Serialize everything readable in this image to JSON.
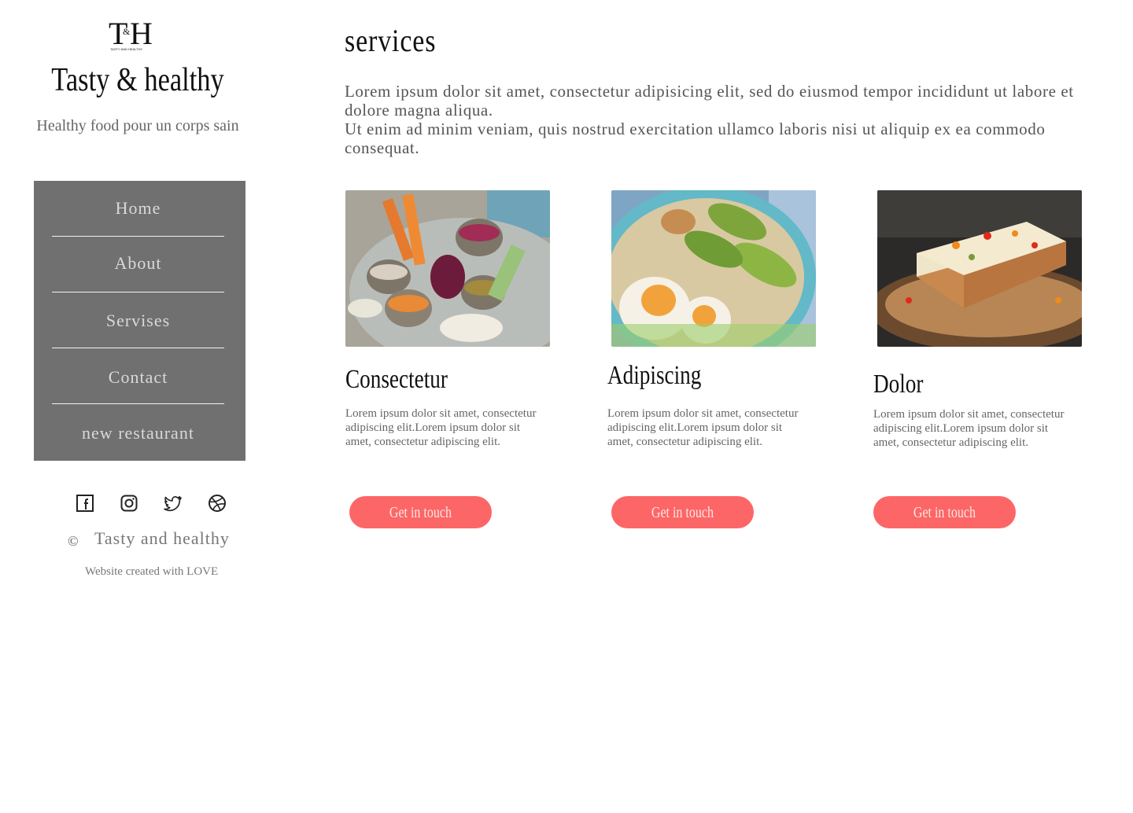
{
  "sidebar": {
    "logo_text": "T&H",
    "logo_subtext": "TASTY AND HEALTHY",
    "brand": "Tasty & healthy",
    "tagline": "Healthy food pour un corps sain",
    "nav": [
      {
        "label": "Home"
      },
      {
        "label": "About"
      },
      {
        "label": "Servises"
      },
      {
        "label": "Contact"
      },
      {
        "label": "new restaurant"
      }
    ],
    "social_icons": [
      "facebook-icon",
      "instagram-icon",
      "twitter-icon",
      "dribbble-icon"
    ],
    "copyright_symbol": "©",
    "copyright_text": "Tasty and healthy",
    "credit": "Website created with LOVE"
  },
  "main": {
    "title": "services",
    "intro_line1": "Lorem ipsum dolor sit amet, consectetur adipisicing elit, sed do eiusmod tempor incididunt ut labore et dolore magna aliqua.",
    "intro_line2": "Ut enim ad minim veniam, quis nostrud exercitation ullamco laboris nisi ut aliquip ex ea commodo consequat.",
    "cards": [
      {
        "title": "Consectetur",
        "text": "Lorem ipsum dolor sit amet, consectetur adipiscing elit.Lorem ipsum dolor sit amet, consectetur adipiscing elit.",
        "button": "Get in touch"
      },
      {
        "title": "Adipiscing",
        "text": "Lorem ipsum dolor sit amet, consectetur adipiscing elit.Lorem ipsum dolor sit amet, consectetur adipiscing elit.",
        "button": "Get in touch"
      },
      {
        "title": "Dolor",
        "text": "Lorem ipsum dolor sit amet, consectetur adipiscing elit.Lorem ipsum dolor sit amet, consectetur adipiscing elit.",
        "button": "Get in touch"
      }
    ]
  },
  "colors": {
    "accent": "#fd6666",
    "nav_bg": "#707070",
    "text": "#555555"
  }
}
